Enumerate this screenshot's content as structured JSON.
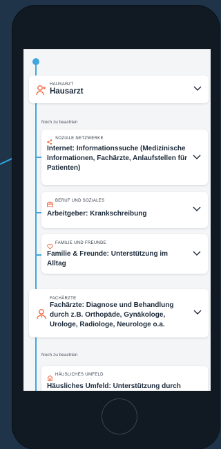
{
  "colors": {
    "accent": "#3fa7de",
    "icon": "#f0643c",
    "background": "#1f3349",
    "card": "#ffffff"
  },
  "cards": {
    "hausarzt": {
      "eyebrow": "HAUSARZT",
      "title": "Hausarzt",
      "icon": "doctor-icon"
    },
    "internet": {
      "eyebrow": "SOZIALE NETZWERKE",
      "title": "Internet: Informationssuche (Medizinische Informationen, Fachärzte, Anlaufstellen für Patienten)",
      "icon": "share-icon"
    },
    "arbeitgeber": {
      "eyebrow": "BERUF UND SOZIALES",
      "title": "Arbeitgeber: Krankschreibung",
      "icon": "briefcase-icon"
    },
    "familie": {
      "eyebrow": "FAMILIE UND FREUNDE",
      "title": "Familie & Freunde: Unterstützung im Alltag",
      "icon": "heart-icon"
    },
    "fachaerzte": {
      "eyebrow": "FACHÄRZTE",
      "title": "Fachärzte: Diagnose und Behandlung durch z.B. Orthopäde, Gynäkologe, Urologe, Radiologe, Neurologe o.a.",
      "icon": "doctor-icon"
    },
    "haeusliches": {
      "eyebrow": "HÄUSLICHES UMFELD",
      "title": "Häusliches Umfeld: Unterstützung durch",
      "icon": "home-icon"
    }
  },
  "sections": {
    "noch1": "Noch zu beachten",
    "noch2": "Noch zu beachten"
  }
}
